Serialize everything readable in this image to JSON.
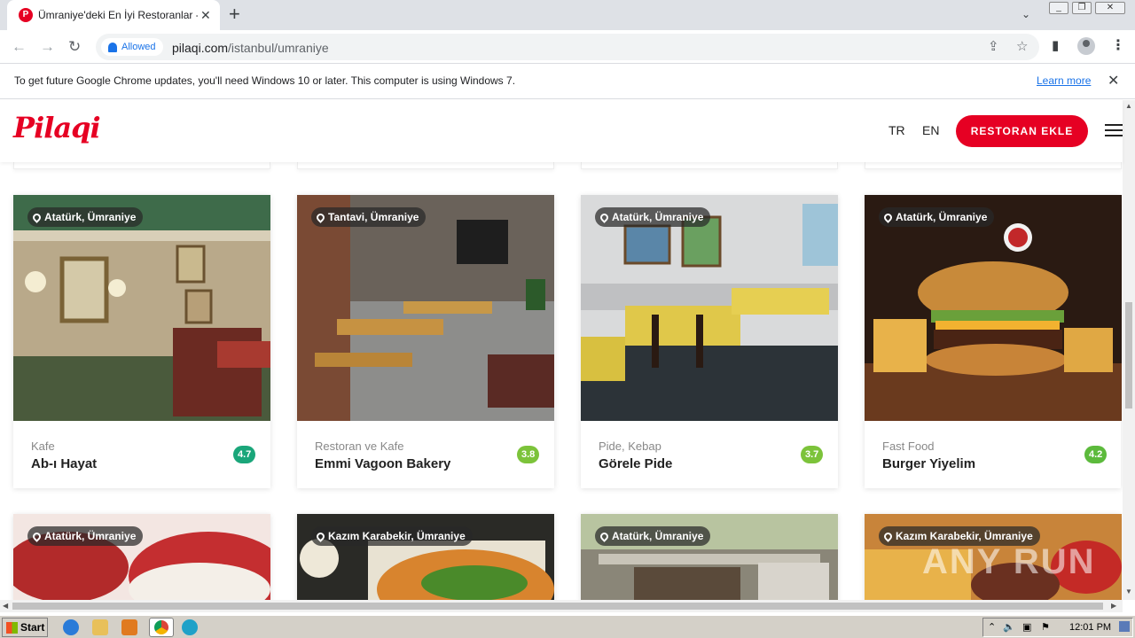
{
  "browser": {
    "tab_title": "Ümraniye'deki En İyi Restoranlar - İs",
    "tab_favicon": "P",
    "permission_chip": "Allowed",
    "url_domain": "pilaqi.com",
    "url_path": "/istanbul/umraniye",
    "infobar_text": "To get future Google Chrome updates, you'll need Windows 10 or later. This computer is using Windows 7.",
    "infobar_link": "Learn more"
  },
  "site": {
    "logo": "Pilaqi",
    "lang_tr": "TR",
    "lang_en": "EN",
    "add_button": "RESTORAN EKLE"
  },
  "cards": [
    {
      "location": "Atatürk, Ümraniye",
      "category": "Kafe",
      "name": "Ab-ı Hayat",
      "rating": "4.7",
      "rating_color": "#1aa67a"
    },
    {
      "location": "Tantavi, Ümraniye",
      "category": "Restoran ve Kafe",
      "name": "Emmi Vagoon Bakery",
      "rating": "3.8",
      "rating_color": "#7cc33a"
    },
    {
      "location": "Atatürk, Ümraniye",
      "category": "Pide, Kebap",
      "name": "Görele Pide",
      "rating": "3.7",
      "rating_color": "#7cc33a"
    },
    {
      "location": "Atatürk, Ümraniye",
      "category": "Fast Food",
      "name": "Burger Yiyelim",
      "rating": "4.2",
      "rating_color": "#5cba3c"
    }
  ],
  "cards_row2": [
    {
      "location": "Atatürk, Ümraniye"
    },
    {
      "location": "Kazım Karabekir, Ümraniye"
    },
    {
      "location": "Atatürk, Ümraniye"
    },
    {
      "location": "Kazım Karabekir, Ümraniye"
    }
  ],
  "taskbar": {
    "start_label": "Start",
    "clock": "12:01 PM"
  },
  "watermark": "ANY RUN"
}
